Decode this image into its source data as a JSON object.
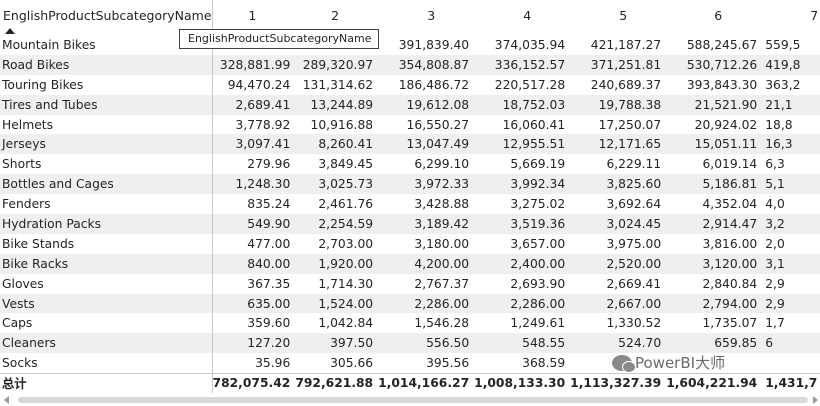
{
  "matrix": {
    "row_header": "EnglishProductSubcategoryName",
    "columns": [
      "1",
      "2",
      "3",
      "4",
      "5",
      "6",
      "7"
    ],
    "rows": [
      {
        "name": "Mountain Bikes",
        "values": [
          "",
          "",
          "391,839.40",
          "374,035.94",
          "421,187.27",
          "588,245.67",
          "559,5"
        ]
      },
      {
        "name": "Road Bikes",
        "values": [
          "328,881.99",
          "289,320.97",
          "354,808.87",
          "336,152.57",
          "371,251.81",
          "530,712.26",
          "419,8"
        ]
      },
      {
        "name": "Touring Bikes",
        "values": [
          "94,470.24",
          "131,314.62",
          "186,486.72",
          "220,517.28",
          "240,689.37",
          "393,843.30",
          "363,2"
        ]
      },
      {
        "name": "Tires and Tubes",
        "values": [
          "2,689.41",
          "13,244.89",
          "19,612.08",
          "18,752.03",
          "19,788.38",
          "21,521.90",
          "21,1"
        ]
      },
      {
        "name": "Helmets",
        "values": [
          "3,778.92",
          "10,916.88",
          "16,550.27",
          "16,060.41",
          "17,250.07",
          "20,924.02",
          "18,8"
        ]
      },
      {
        "name": "Jerseys",
        "values": [
          "3,097.41",
          "8,260.41",
          "13,047.49",
          "12,955.51",
          "12,171.65",
          "15,051.11",
          "16,3"
        ]
      },
      {
        "name": "Shorts",
        "values": [
          "279.96",
          "3,849.45",
          "6,299.10",
          "5,669.19",
          "6,229.11",
          "6,019.14",
          "6,3"
        ]
      },
      {
        "name": "Bottles and Cages",
        "values": [
          "1,248.30",
          "3,025.73",
          "3,972.33",
          "3,992.34",
          "3,825.60",
          "5,186.81",
          "5,1"
        ]
      },
      {
        "name": "Fenders",
        "values": [
          "835.24",
          "2,461.76",
          "3,428.88",
          "3,275.02",
          "3,692.64",
          "4,352.04",
          "4,0"
        ]
      },
      {
        "name": "Hydration Packs",
        "values": [
          "549.90",
          "2,254.59",
          "3,189.42",
          "3,519.36",
          "3,024.45",
          "2,914.47",
          "3,2"
        ]
      },
      {
        "name": "Bike Stands",
        "values": [
          "477.00",
          "2,703.00",
          "3,180.00",
          "3,657.00",
          "3,975.00",
          "3,816.00",
          "2,0"
        ]
      },
      {
        "name": "Bike Racks",
        "values": [
          "840.00",
          "1,920.00",
          "4,200.00",
          "2,400.00",
          "2,520.00",
          "3,120.00",
          "3,1"
        ]
      },
      {
        "name": "Gloves",
        "values": [
          "367.35",
          "1,714.30",
          "2,767.37",
          "2,693.90",
          "2,669.41",
          "2,840.84",
          "2,9"
        ]
      },
      {
        "name": "Vests",
        "values": [
          "635.00",
          "1,524.00",
          "2,286.00",
          "2,286.00",
          "2,667.00",
          "2,794.00",
          "2,9"
        ]
      },
      {
        "name": "Caps",
        "values": [
          "359.60",
          "1,042.84",
          "1,546.28",
          "1,249.61",
          "1,330.52",
          "1,735.07",
          "1,7"
        ]
      },
      {
        "name": "Cleaners",
        "values": [
          "127.20",
          "397.50",
          "556.50",
          "548.55",
          "524.70",
          "659.85",
          "6"
        ]
      },
      {
        "name": "Socks",
        "values": [
          "35.96",
          "305.66",
          "395.56",
          "368.59",
          "",
          "",
          ""
        ]
      }
    ],
    "total": {
      "name": "总计",
      "values": [
        "782,075.42",
        "792,621.88",
        "1,014,166.27",
        "1,008,133.30",
        "1,113,327.39",
        "1,604,221.94",
        "1,431,7"
      ]
    }
  },
  "tooltip": {
    "text": "EnglishProductSubcategoryName"
  },
  "watermark": {
    "text": "PowerBI大师"
  },
  "colors": {
    "stripe": "#efefef",
    "text": "#252423",
    "border": "#c8c8c8"
  }
}
